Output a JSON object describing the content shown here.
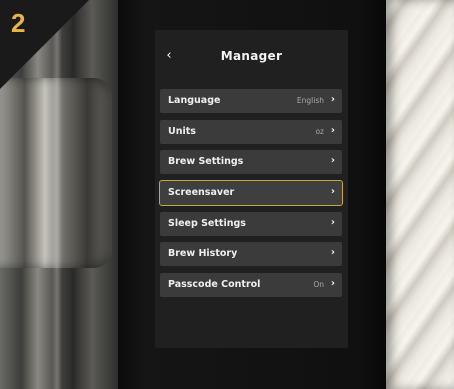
{
  "step_badge": "2",
  "screen": {
    "title": "Manager",
    "back_glyph": "‹",
    "items": [
      {
        "label": "Language",
        "value": "English",
        "selected": false
      },
      {
        "label": "Units",
        "value": "oz",
        "selected": false
      },
      {
        "label": "Brew Settings",
        "value": "",
        "selected": false
      },
      {
        "label": "Screensaver",
        "value": "",
        "selected": true
      },
      {
        "label": "Sleep Settings",
        "value": "",
        "selected": false
      },
      {
        "label": "Brew History",
        "value": "",
        "selected": false
      },
      {
        "label": "Passcode Control",
        "value": "On",
        "selected": false
      }
    ],
    "chevron_glyph": "›"
  },
  "colors": {
    "accent_badge": "#e7b34a",
    "selected_outline": "#c9a441",
    "row_bg": "#3b3b3b",
    "screen_bg": "#202020"
  },
  "icons": {
    "back": "chevron-left-icon",
    "row_arrow": "chevron-right-icon"
  }
}
